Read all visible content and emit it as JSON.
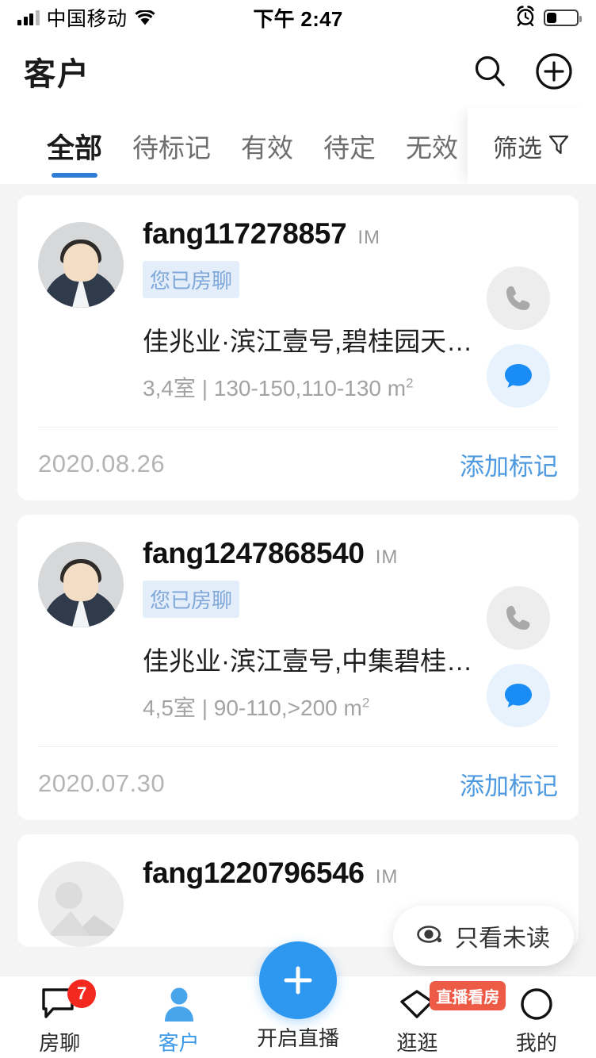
{
  "status_bar": {
    "carrier": "中国移动",
    "time": "下午 2:47",
    "signal_icon": "signal-bars-icon",
    "wifi_icon": "wifi-icon",
    "alarm_icon": "alarm-clock-icon",
    "battery_icon": "battery-icon",
    "battery_level": 32
  },
  "header": {
    "title": "客户",
    "search_icon": "search-icon",
    "add_icon": "plus-circle-icon"
  },
  "tabs": {
    "items": [
      {
        "label": "全部",
        "active": true
      },
      {
        "label": "待标记",
        "active": false
      },
      {
        "label": "有效",
        "active": false
      },
      {
        "label": "待定",
        "active": false
      },
      {
        "label": "无效",
        "active": false
      }
    ],
    "filter_label": "筛选",
    "filter_icon": "funnel-icon",
    "indicator_color": "#2e7cd6"
  },
  "cards": [
    {
      "avatar": "default-male-avatar",
      "username": "fang117278857",
      "source_tag": "IM",
      "chat_badge": "您已房聊",
      "property": "佳兆业·滨江壹号,碧桂园天悦…",
      "spec": "3,4室 | 130-150,110-130 ㎡",
      "date": "2020.08.26",
      "action": "添加标记",
      "call_icon": "phone-icon",
      "message_icon": "chat-bubble-icon"
    },
    {
      "avatar": "default-male-avatar",
      "username": "fang1247868540",
      "source_tag": "IM",
      "chat_badge": "您已房聊",
      "property": "佳兆业·滨江壹号,中集碧桂园…",
      "spec": "4,5室 | 90-110,>200 ㎡",
      "date": "2020.07.30",
      "action": "添加标记",
      "call_icon": "phone-icon",
      "message_icon": "chat-bubble-icon"
    },
    {
      "avatar": "image-placeholder-avatar",
      "username": "fang1220796546",
      "source_tag": "IM",
      "chat_badge": "",
      "property": "",
      "spec": "",
      "date": "",
      "action": "",
      "call_icon": "phone-icon",
      "message_icon": "chat-bubble-icon"
    }
  ],
  "unread_filter": {
    "label": "只看未读",
    "icon": "eye-icon"
  },
  "bottom_nav": {
    "items": [
      {
        "label": "房聊",
        "icon": "chat-square-icon",
        "badge": "7",
        "active": false
      },
      {
        "label": "客户",
        "icon": "person-icon",
        "badge": "",
        "active": true
      },
      {
        "label": "开启直播",
        "icon": "plus-icon",
        "badge": "",
        "active": false
      },
      {
        "label": "逛逛",
        "icon": "diamond-icon",
        "badge": "直播看房",
        "active": false
      },
      {
        "label": "我的",
        "icon": "circle-icon",
        "badge": "",
        "active": false
      }
    ],
    "accent_color": "#2e97f0",
    "badge_color": "#f3291f"
  }
}
